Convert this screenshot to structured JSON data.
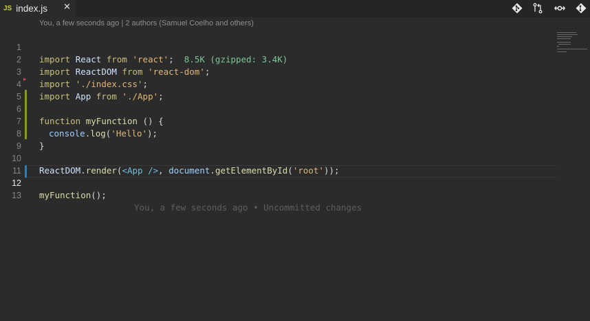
{
  "tab": {
    "lang_badge": "JS",
    "filename": "index.js",
    "close": "✕"
  },
  "toolbar": {
    "icons": [
      "git-diamond-icon",
      "compare-changes-icon",
      "open-changes-icon",
      "git-blame-icon"
    ]
  },
  "codelens": "You, a few seconds ago | 2 authors (Samuel Coelho and others)",
  "lines": [
    {
      "num": "1"
    },
    {
      "num": "2"
    },
    {
      "num": "3"
    },
    {
      "num": "4"
    },
    {
      "num": "5"
    },
    {
      "num": "6"
    },
    {
      "num": "7"
    },
    {
      "num": "8"
    },
    {
      "num": "9"
    },
    {
      "num": "10"
    },
    {
      "num": "11"
    },
    {
      "num": "12"
    },
    {
      "num": "13"
    }
  ],
  "code": {
    "l1": {
      "import": "import",
      "name": "React",
      "from": "from",
      "str": "'react'",
      "semi": ";",
      "size": "8.5K (gzipped: 3.4K)"
    },
    "l2": {
      "import": "import",
      "name": "ReactDOM",
      "from": "from",
      "str": "'react-dom'",
      "semi": ";"
    },
    "l3": {
      "import": "import",
      "str": "'./index.css'",
      "semi": ";"
    },
    "l4": {
      "import": "import",
      "name": "App",
      "from": "from",
      "str": "'./App'",
      "semi": ";"
    },
    "l6": {
      "kw": "function",
      "name": "myFunction",
      "rest": " () {"
    },
    "l7": {
      "obj": "console",
      "dot": ".",
      "fn": "log",
      "open": "(",
      "str": "'Hello'",
      "close": ");"
    },
    "l8": {
      "brace": "}"
    },
    "l10": {
      "obj": "ReactDOM",
      "dot": ".",
      "fn": "render",
      "open": "(",
      "tag": "<App />",
      "comma": ", ",
      "doc": "document",
      "dot2": ".",
      "fn2": "getElementById",
      "open2": "(",
      "str": "'root'",
      "close": "));"
    },
    "l12": {
      "fn": "myFunction",
      "rest": "();",
      "blame": "You, a few seconds ago • Uncommitted changes"
    }
  },
  "colors": {
    "added_gutter": "#8a9a2a",
    "modified_gutter": "#2d7fb0",
    "background": "#2b2b2b"
  }
}
